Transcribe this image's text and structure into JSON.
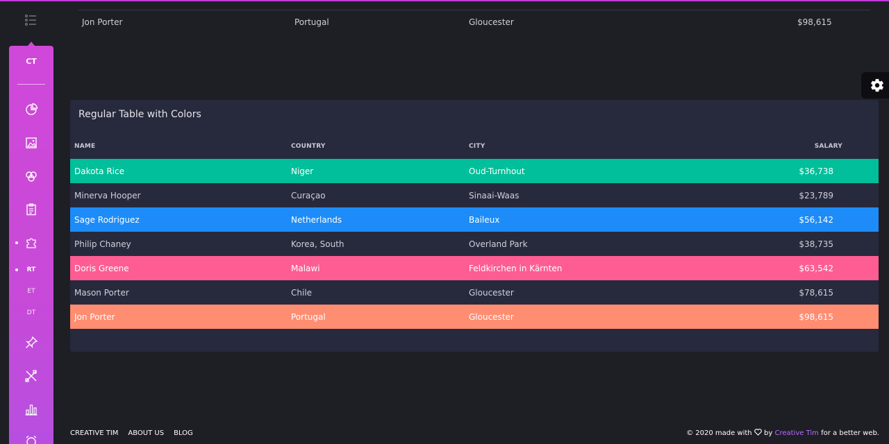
{
  "sidebar": {
    "logo": "CT",
    "items": [
      {
        "icon": "chart-pie-icon"
      },
      {
        "icon": "image-icon"
      },
      {
        "icon": "atom-icon"
      },
      {
        "icon": "clipboard-icon"
      },
      {
        "icon": "puzzle-icon"
      }
    ],
    "sub_items": [
      {
        "label": "RT"
      },
      {
        "label": "ET"
      },
      {
        "label": "DT"
      }
    ],
    "items_bottom": [
      {
        "icon": "pin-icon"
      },
      {
        "icon": "tools-icon"
      },
      {
        "icon": "bar-chart-icon"
      },
      {
        "icon": "alarm-icon"
      }
    ]
  },
  "top_row": {
    "name": "Jon Porter",
    "country": "Portugal",
    "city": "Gloucester",
    "salary": "$98,615"
  },
  "card": {
    "title": "Regular Table with Colors",
    "columns": [
      "NAME",
      "COUNTRY",
      "CITY",
      "SALARY"
    ],
    "rows": [
      {
        "name": "Dakota Rice",
        "country": "Niger",
        "city": "Oud-Turnhout",
        "salary": "$36,738",
        "color": "#00bf9a"
      },
      {
        "name": "Minerva Hooper",
        "country": "Curaçao",
        "city": "Sinaai-Waas",
        "salary": "$23,789",
        "color": ""
      },
      {
        "name": "Sage Rodriguez",
        "country": "Netherlands",
        "city": "Baileux",
        "salary": "$56,142",
        "color": "#1d8cf8"
      },
      {
        "name": "Philip Chaney",
        "country": "Korea, South",
        "city": "Overland Park",
        "salary": "$38,735",
        "color": ""
      },
      {
        "name": "Doris Greene",
        "country": "Malawi",
        "city": "Feldkirchen in Kärnten",
        "salary": "$63,542",
        "color": "#fd5d93"
      },
      {
        "name": "Mason Porter",
        "country": "Chile",
        "city": "Gloucester",
        "salary": "$78,615",
        "color": ""
      },
      {
        "name": "Jon Porter",
        "country": "Portugal",
        "city": "Gloucester",
        "salary": "$98,615",
        "color": "#ff8d72"
      }
    ]
  },
  "footer": {
    "links": [
      "CREATIVE TIM",
      "ABOUT US",
      "BLOG"
    ],
    "copyright_prefix": "© 2020 made with",
    "copyright_by": "by",
    "brand": "Creative Tim",
    "copyright_suffix": "for a better web."
  },
  "colors": {
    "background": "#1e1e25",
    "card": "#272a3d",
    "sidebar": "#d048d9",
    "brand_link": "#b76cff"
  }
}
